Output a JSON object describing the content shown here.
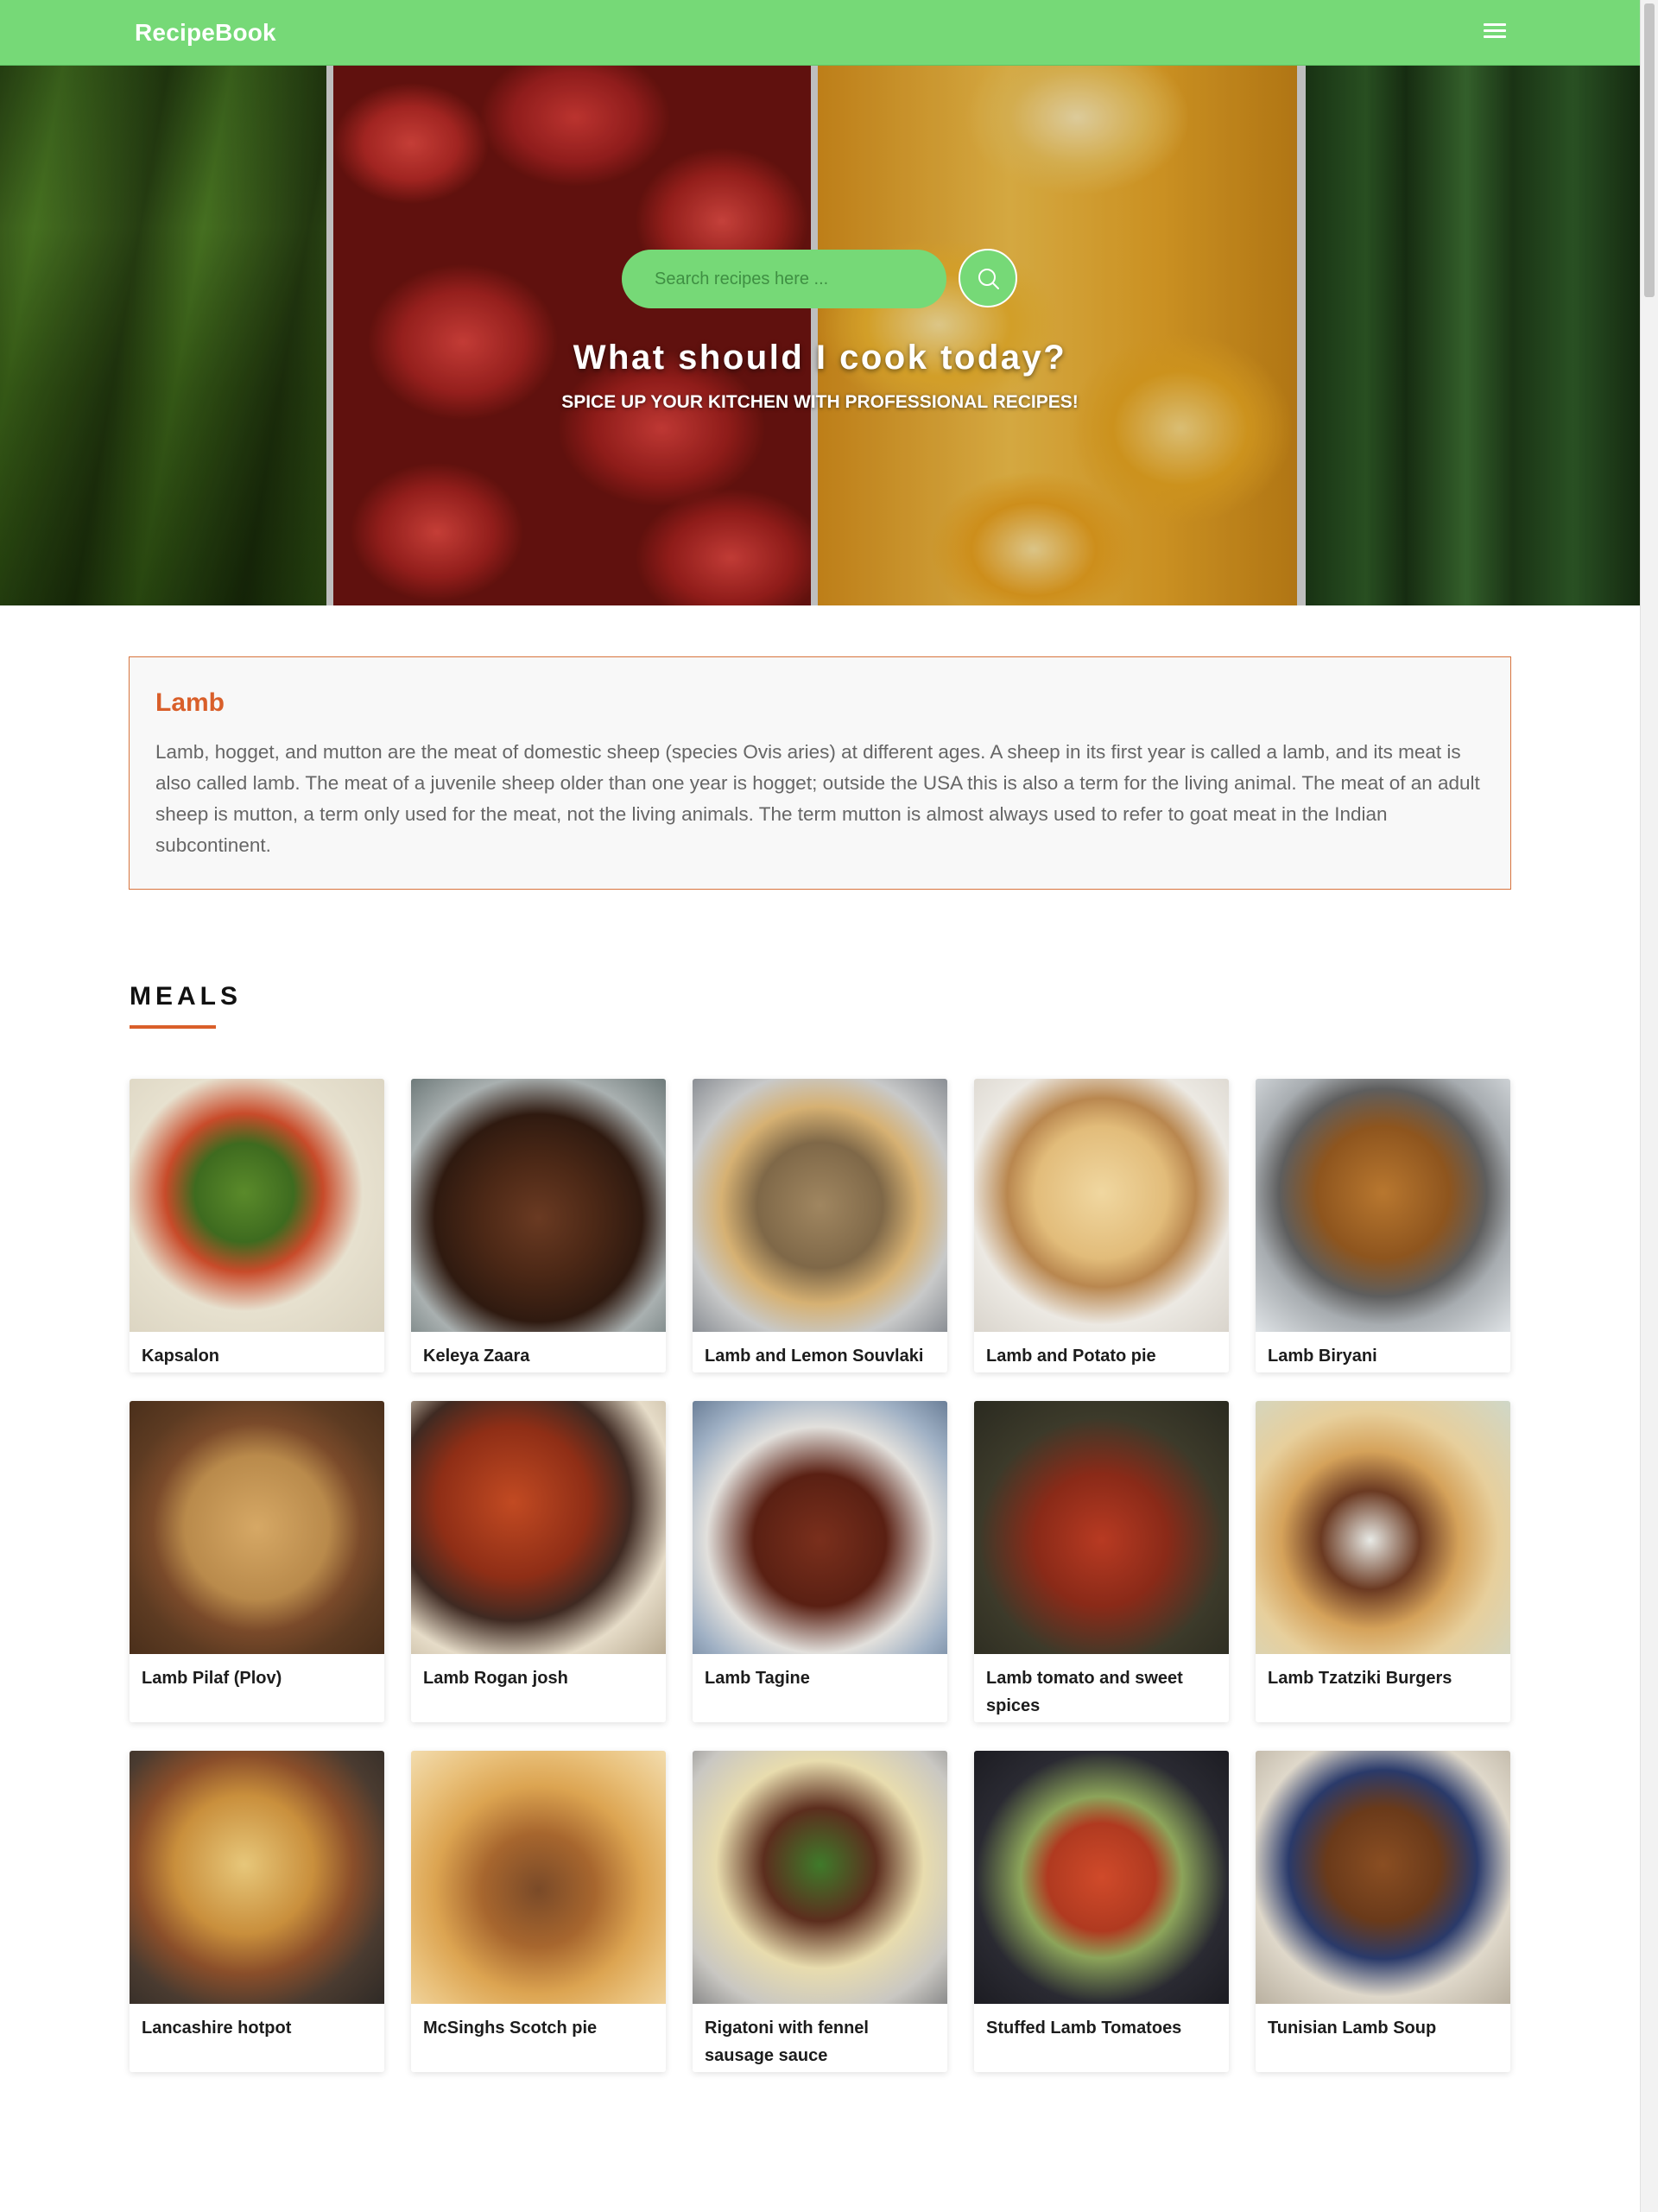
{
  "navbar": {
    "brand": "RecipeBook",
    "menu_icon": "hamburger-menu-icon",
    "color": "#76d977"
  },
  "hero": {
    "search_placeholder": "Search recipes here ...",
    "search_icon": "search-icon",
    "title": "What should I cook today?",
    "subtitle": "SPICE UP YOUR KITCHEN WITH PROFESSIONAL RECIPES!"
  },
  "category": {
    "name": "Lamb",
    "description": "Lamb, hogget, and mutton are the meat of domestic sheep (species Ovis aries) at different ages. A sheep in its first year is called a lamb, and its meat is also called lamb. The meat of a juvenile sheep older than one year is hogget; outside the USA this is also a term for the living animal. The meat of an adult sheep is mutton, a term only used for the meat, not the living animals. The term mutton is almost always used to refer to goat meat in the Indian subcontinent.",
    "accent": "#d95f2a"
  },
  "meals": {
    "heading": "MEALS",
    "items": [
      {
        "name": "Kapsalon"
      },
      {
        "name": "Keleya Zaara"
      },
      {
        "name": "Lamb and Lemon Souvlaki"
      },
      {
        "name": "Lamb and Potato pie"
      },
      {
        "name": "Lamb Biryani"
      },
      {
        "name": "Lamb Pilaf (Plov)"
      },
      {
        "name": "Lamb Rogan josh"
      },
      {
        "name": "Lamb Tagine"
      },
      {
        "name": "Lamb tomato and sweet spices"
      },
      {
        "name": "Lamb Tzatziki Burgers"
      },
      {
        "name": "Lancashire hotpot"
      },
      {
        "name": "McSinghs Scotch pie"
      },
      {
        "name": "Rigatoni with fennel sausage sauce"
      },
      {
        "name": "Stuffed Lamb Tomatoes"
      },
      {
        "name": "Tunisian Lamb Soup"
      }
    ]
  }
}
